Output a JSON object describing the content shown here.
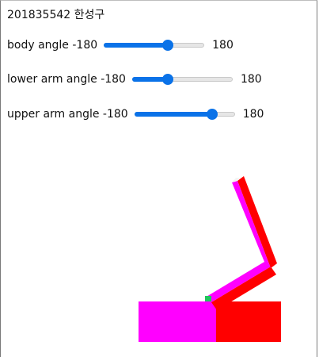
{
  "title": "201835542 한성구",
  "sliders": [
    {
      "label": "body angle -180",
      "max_label": "180",
      "value": 56
    },
    {
      "label": "lower arm angle -180",
      "max_label": "180",
      "value": -60
    },
    {
      "label": "upper arm angle -180",
      "max_label": "180",
      "value": 110
    }
  ],
  "slider_range": [
    -180,
    180
  ],
  "colors": {
    "accent": "#0a72e8",
    "magenta": "#ff00ff",
    "red": "#ff0000",
    "joint": "#22c55e"
  }
}
